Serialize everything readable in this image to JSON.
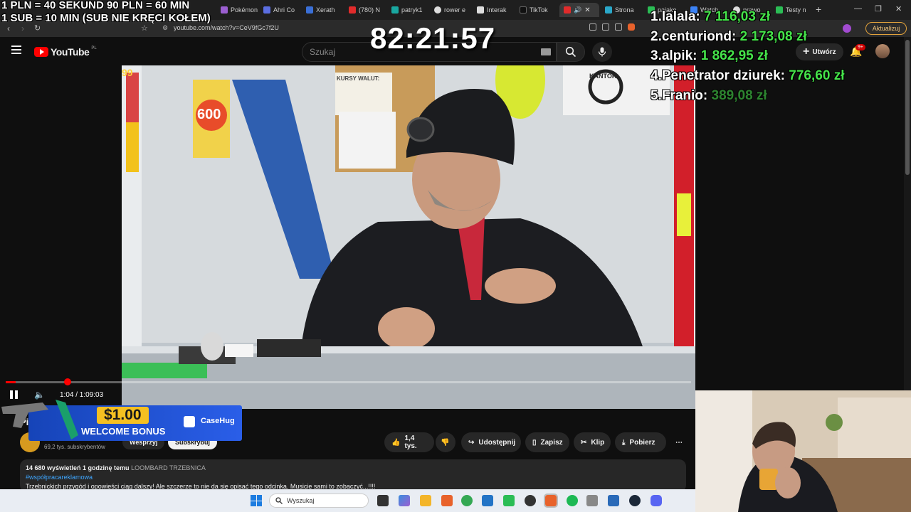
{
  "browser": {
    "tabs": [
      {
        "label": "Pokémon",
        "color": "#9b5fd1"
      },
      {
        "label": "Ahri Co",
        "color": "#5b6ee1"
      },
      {
        "label": "Xerath",
        "color": "#3a6fd6"
      },
      {
        "label": "(780) N",
        "color": "#e12b2b"
      },
      {
        "label": "patryk1",
        "color": "#19a7a0"
      },
      {
        "label": "rower e",
        "color": "#dddddd"
      },
      {
        "label": "Interak",
        "color": "#dddddd"
      },
      {
        "label": "TikTok",
        "color": "#111111"
      },
      {
        "label": "Strona",
        "color": "#2aa7c8"
      },
      {
        "label": "pajako",
        "color": "#2bbd55"
      },
      {
        "label": "Watch",
        "color": "#3b82f6"
      },
      {
        "label": "prawo",
        "color": "#dddddd"
      },
      {
        "label": "Testy n",
        "color": "#2bbd55"
      }
    ],
    "url": "youtube.com/watch?v=CeV9fGc7f2U",
    "update_label": "Aktualizuj",
    "add_tab": "+"
  },
  "yt": {
    "logo": "YouTube",
    "logo_country": "PL",
    "search_placeholder": "Szukaj",
    "create_label": "Utwórz",
    "notif_badge": "9+",
    "time_display": "1:04 / 1:09:03",
    "channel_partial": "Pi",
    "subs_text": "69,2 tys. subskrybentów",
    "support_label": "Wesprzyj",
    "subscribe_label": "Subskrybuj",
    "likes": "1,4 tys.",
    "share_label": "Udostępnij",
    "save_label": "Zapisz",
    "clip_label": "Klip",
    "download_label": "Pobierz",
    "views_time": "14 680 wyświetleń  1 godzinę temu",
    "channel_tag": "LOOMBARD TRZEBNICA",
    "hashtag": "#współpracareklamowa",
    "description": "Trzebnickich przygód i opowieści ciąg dalszy! Ale szczerze to nie da się opisać tego odcinka. Musicie sami to zobaczyć...!!!!",
    "progress_fraction": 0.015
  },
  "stream": {
    "rules_line1": "1 PLN =  40 SEKUND 90 PLN = 60 MIN",
    "rules_line2": "1 SUB = 10 MIN (SUB NIE KRĘCI KOŁEM)",
    "timer": "82:21:57",
    "leaderboard": [
      {
        "rank": "1.",
        "name": "lalala:",
        "amount": "7 116,03 zł"
      },
      {
        "rank": "2.",
        "name": "centuriond:",
        "amount": "2 173,08 zł"
      },
      {
        "rank": "3.",
        "name": "alpik:",
        "amount": "1 862,95 zł"
      },
      {
        "rank": "4.",
        "name": "Penetrator dziurek:",
        "amount": "776,60 zł"
      },
      {
        "rank": "5.",
        "name": "Franio:",
        "amount": "389,08 zł"
      }
    ],
    "ad_amount": "$1.00",
    "ad_text": "WELCOME BONUS",
    "ad_brand": "CaseHug"
  },
  "video_scene": {
    "sign_kursy": "KURSY WALUT:",
    "sign_kantor": "KANTOR",
    "sign_600": "600",
    "sign_99": "99"
  },
  "taskbar": {
    "search_placeholder": "Wyszukaj"
  }
}
